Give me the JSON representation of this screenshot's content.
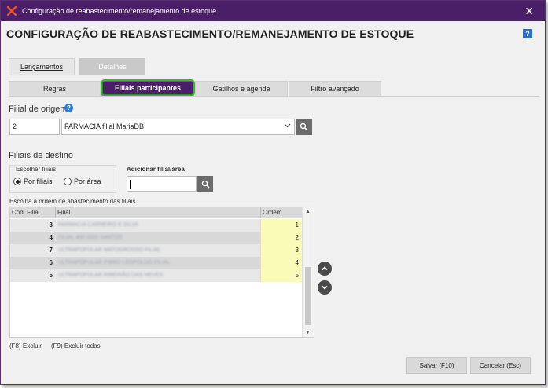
{
  "window": {
    "title": "Configuração de reabastecimento/remanejamento de estoque",
    "close_label": "✕"
  },
  "page": {
    "title": "CONFIGURAÇÃO DE REABASTECIMENTO/REMANEJAMENTO DE ESTOQUE",
    "help_label": "?"
  },
  "main_tabs": [
    {
      "label": "Lançamentos",
      "active": false
    },
    {
      "label": "Detalhes",
      "active": true
    }
  ],
  "sub_tabs": [
    {
      "label": "Regras",
      "active": false
    },
    {
      "label": "Filiais participantes",
      "active": true
    },
    {
      "label": "Gatilhos e agenda",
      "active": false
    },
    {
      "label": "Filtro avançado",
      "active": false
    }
  ],
  "origem": {
    "label": "Filial de origem",
    "info_label": "?",
    "code": "2",
    "name": "FARMACIA filial MariaDB"
  },
  "destino": {
    "label": "Filiais de destino",
    "choose_label": "Escolher filiais",
    "radio_filiais": "Por filiais",
    "radio_area": "Por área",
    "selected": "filiais",
    "add_label": "Adicionar filial/área",
    "add_value": ""
  },
  "grid": {
    "caption": "Escolha a ordem de abastecimento das filiais",
    "headers": {
      "cod": "Cód. Filial",
      "filial": "Filial",
      "ordem": "Ordem"
    },
    "rows": [
      {
        "cod": "3",
        "filial": "FARMACIA CARNEIRO E SILVA",
        "ordem": "1"
      },
      {
        "cod": "4",
        "filial": "FILIAL 400 DOS SANTOS",
        "ordem": "2"
      },
      {
        "cod": "7",
        "filial": "ULTRAPOPULAR MATOGROSSO FILIAL",
        "ordem": "3"
      },
      {
        "cod": "6",
        "filial": "ULTRAPOPULAR PIBRO LEOPOLDO FILIAL",
        "ordem": "4"
      },
      {
        "cod": "5",
        "filial": "ULTRAPOPULAR RIBEIRÃO DAS NEVES",
        "ordem": "5"
      }
    ]
  },
  "shortcuts": {
    "excluir": "(F8)  Excluir",
    "excluir_todas": "(F9)  Excluir todas"
  },
  "footer": {
    "save": "Salvar (F10)",
    "cancel": "Cancelar (Esc)"
  },
  "colors": {
    "titlebar": "#4b1f68",
    "active_tab": "#4b1f68",
    "highlight_border": "#3fb13a",
    "ordem_cell": "#fbfbb8"
  }
}
